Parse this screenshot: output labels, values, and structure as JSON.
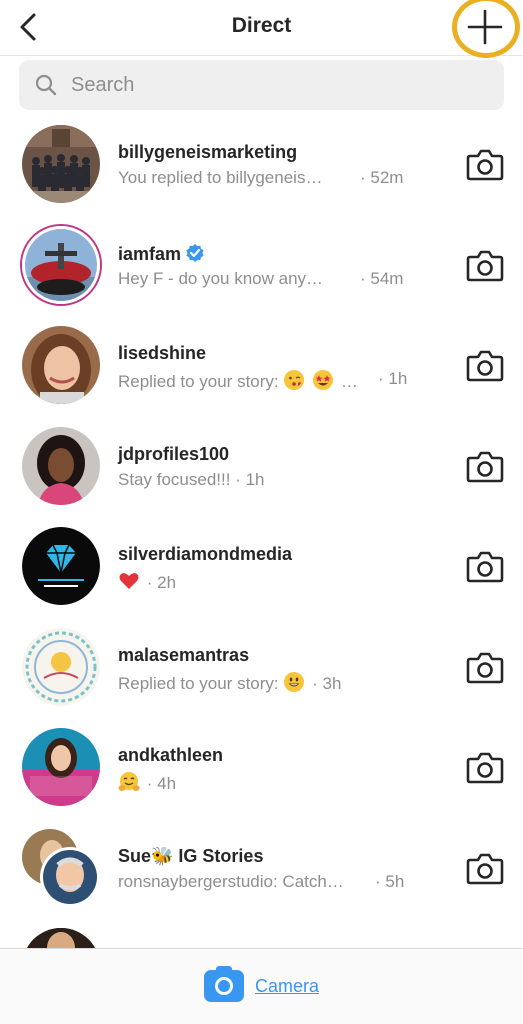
{
  "header": {
    "title": "Direct",
    "accent_ring_color": "#e8b022"
  },
  "search": {
    "placeholder": "Search"
  },
  "threads": [
    {
      "name": "billygeneismarketing",
      "preview": "You replied to billygeneis…",
      "time": "· 52m",
      "verified": false,
      "avatar": "group-photo"
    },
    {
      "name": "iamfam",
      "preview": "Hey F - do you know any…",
      "time": "· 54m",
      "verified": true,
      "avatar": "airplane-photo"
    },
    {
      "name": "lisedshine",
      "preview": "Replied to your story:",
      "preview_emojis": [
        "kissing-face",
        "star-struck"
      ],
      "preview_suffix": "…",
      "time": "· 1h",
      "verified": false,
      "avatar": "woman-portrait"
    },
    {
      "name": "jdprofiles100",
      "preview": "Stay focused!!!",
      "time": "· 1h",
      "verified": false,
      "avatar": "woman-portrait-dark"
    },
    {
      "name": "silverdiamondmedia",
      "preview": "",
      "preview_emojis": [
        "red-heart"
      ],
      "time": "· 2h",
      "verified": false,
      "avatar": "diamond-logo"
    },
    {
      "name": "malasemantras",
      "preview": "Replied to your story:",
      "preview_emojis": [
        "grinning-face"
      ],
      "time": "· 3h",
      "verified": false,
      "avatar": "mandala-logo"
    },
    {
      "name": "andkathleen",
      "preview": "",
      "preview_emojis": [
        "hugging-face"
      ],
      "time": "· 4h",
      "verified": false,
      "avatar": "boss-portrait"
    },
    {
      "name": "Sue🐝 IG Stories",
      "preview": "ronsnaybergerstudio: Catch…",
      "time": "· 5h",
      "verified": false,
      "avatar": "group-avatar"
    }
  ],
  "bottom": {
    "camera_label": "Camera"
  },
  "colors": {
    "text": "#262626",
    "muted": "#8e8e8e",
    "link": "#3897f0",
    "verified": "#3897f0"
  }
}
